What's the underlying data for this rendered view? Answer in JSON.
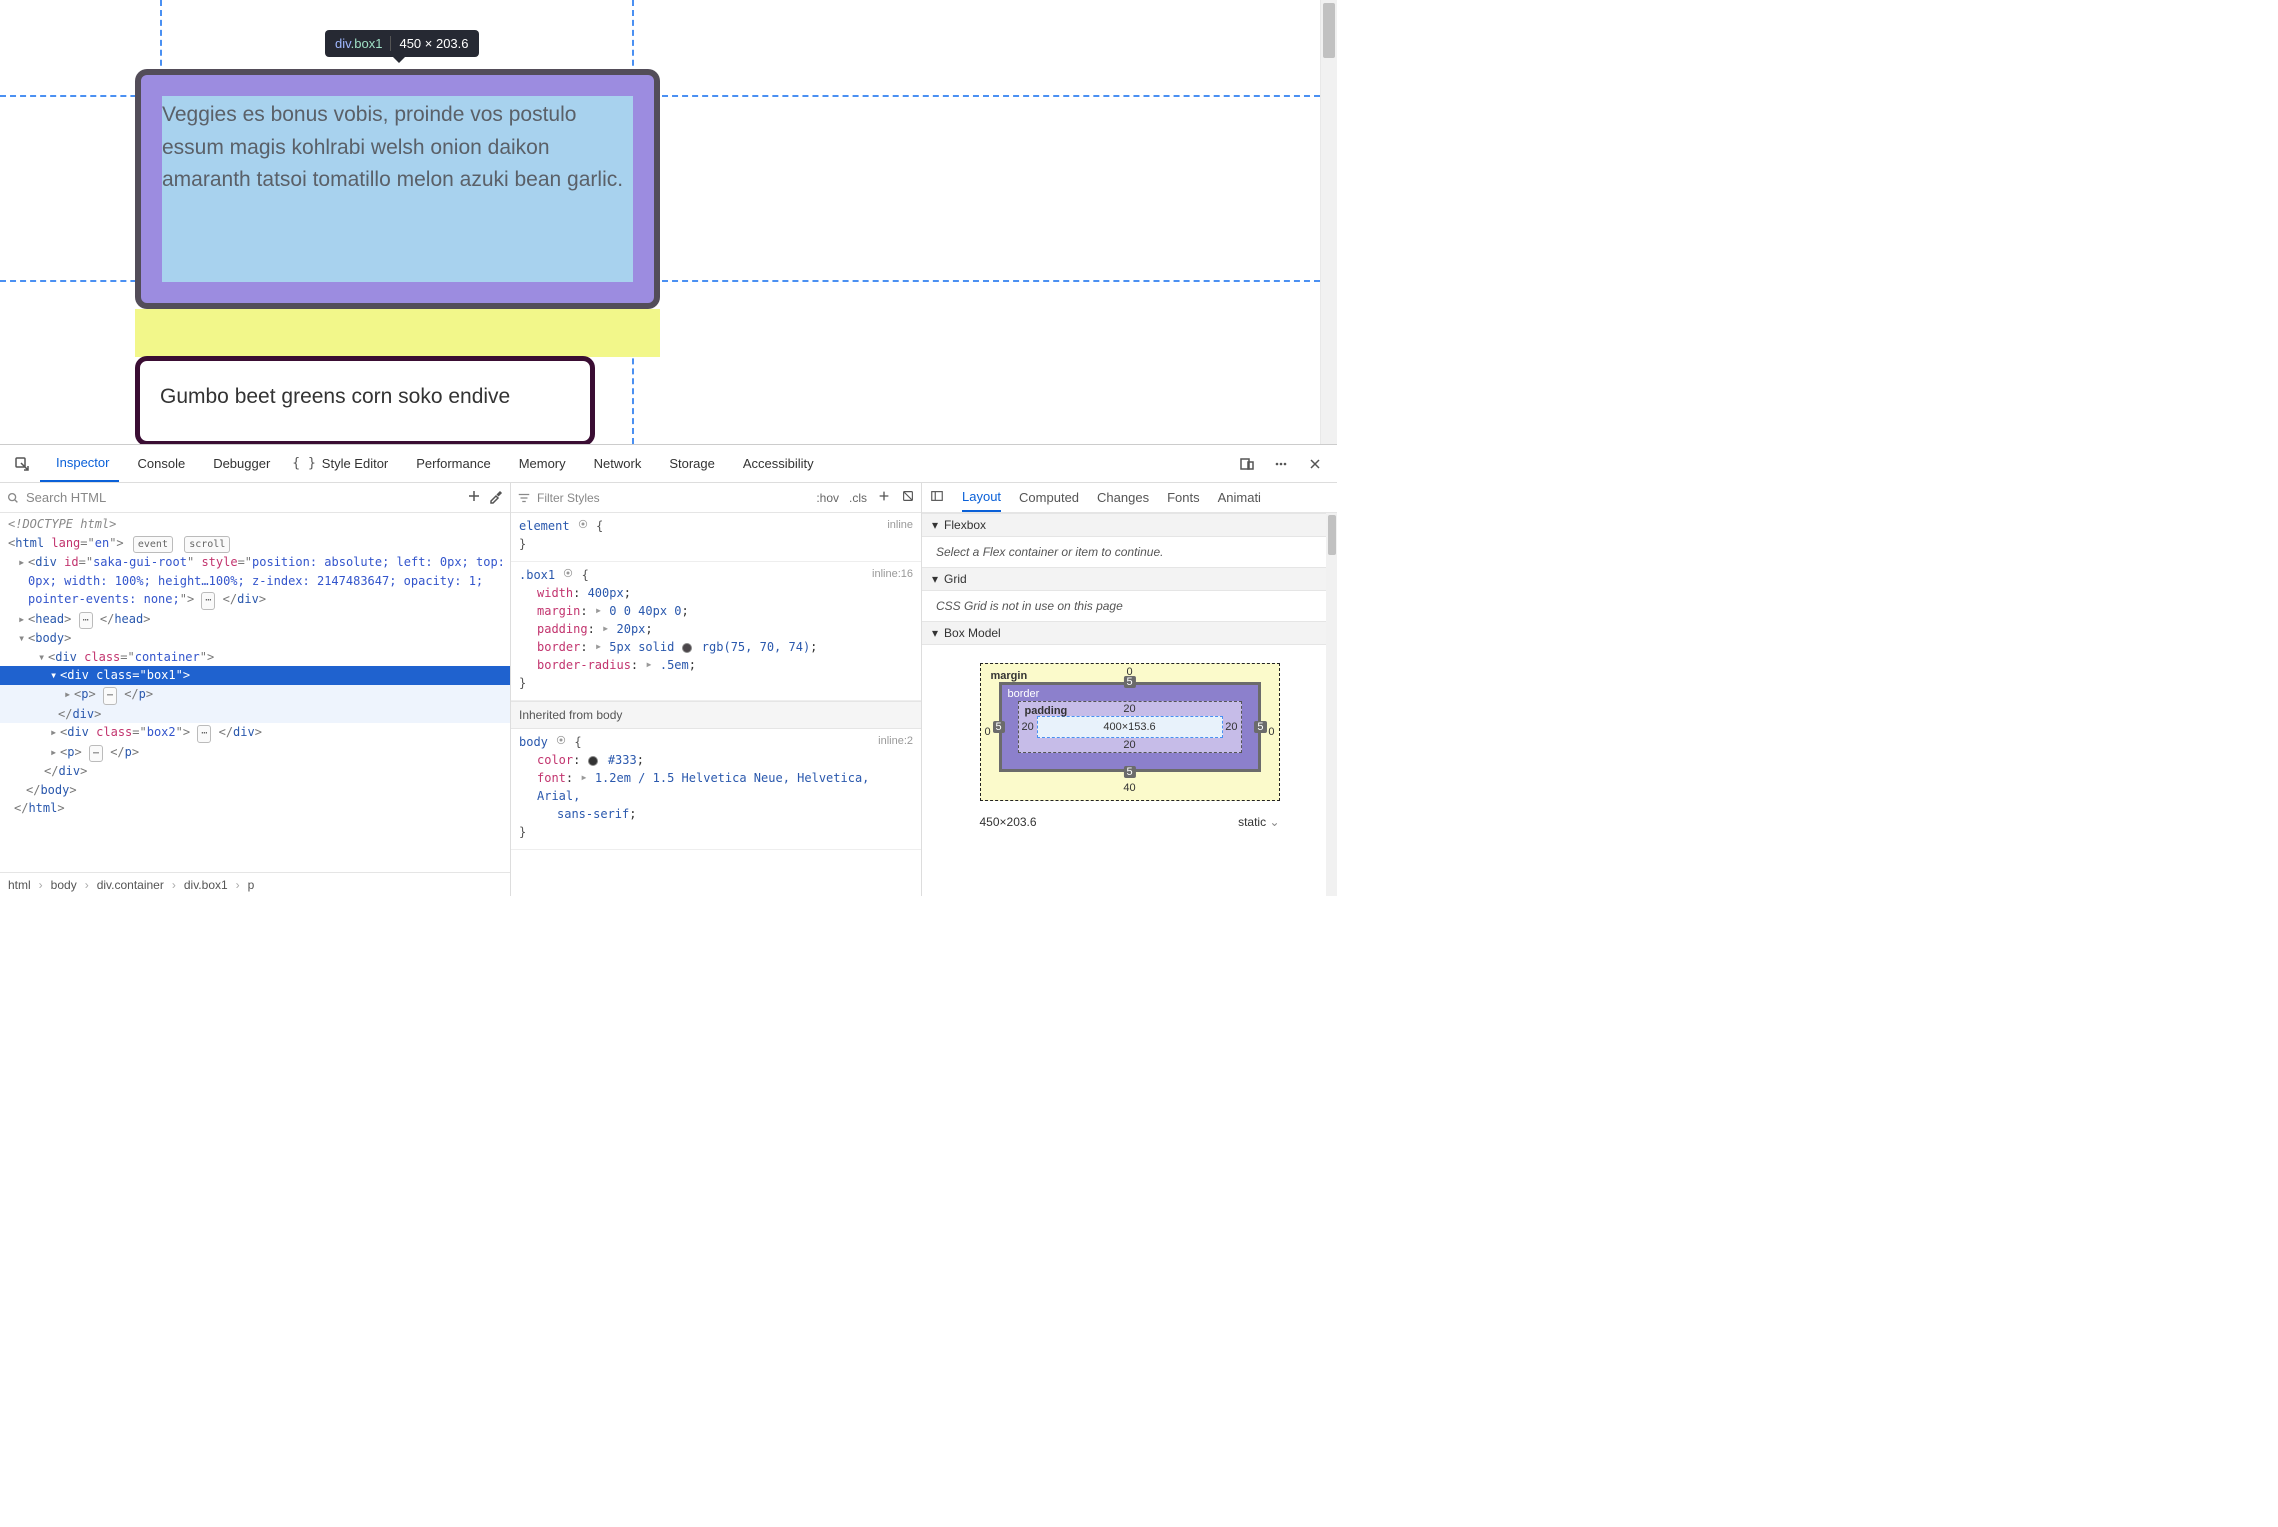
{
  "tooltip": {
    "tag": "div",
    "class": ".box1",
    "dimensions": "450 × 203.6"
  },
  "page": {
    "box1_text": "Veggies es bonus vobis, proinde vos postulo essum magis kohlrabi welsh onion daikon amaranth tatsoi tomatillo melon azuki bean garlic.",
    "box2_text": "Gumbo beet greens corn soko endive"
  },
  "devtools": {
    "tabs": {
      "inspector": "Inspector",
      "console": "Console",
      "debugger": "Debugger",
      "style_editor": "Style Editor",
      "performance": "Performance",
      "memory": "Memory",
      "network": "Network",
      "storage": "Storage",
      "accessibility": "Accessibility"
    },
    "dom_search_placeholder": "Search HTML",
    "dom_tree": {
      "doctype": "<!DOCTYPE html>",
      "html_open": "<html lang=\"en\">",
      "badges": {
        "event": "event",
        "scroll": "scroll"
      },
      "saka_line": "<div id=\"saka-gui-root\" style=\"position: absolute; left: 0px; top: 0px; width: 100%; height…100%; z-index: 2147483647; opacity: 1; pointer-events: none;\"> … </div>",
      "head": "<head> … </head>",
      "body_open": "<body>",
      "container_open": "<div class=\"container\">",
      "box1_open": "<div class=\"box1\">",
      "p_open": "<p> … </p>",
      "div_close": "</div>",
      "box2": "<div class=\"box2\"> … </div>",
      "p_open2": "<p> … </p>",
      "body_close": "</body>",
      "html_close": "</html>"
    },
    "breadcrumbs": [
      "html",
      "body",
      "div.container",
      "div.box1",
      "p"
    ],
    "rules": {
      "filter_placeholder": "Filter Styles",
      "hov": ":hov",
      "cls": ".cls",
      "element": {
        "selector": "element",
        "src": "inline"
      },
      "box1": {
        "selector": ".box1",
        "src": "inline:16",
        "declarations": [
          {
            "prop": "width",
            "value": "400px"
          },
          {
            "prop": "margin",
            "value": "0 0 40px 0",
            "expand": true
          },
          {
            "prop": "padding",
            "value": "20px",
            "expand": true
          },
          {
            "prop": "border",
            "value": "5px solid rgb(75, 70, 74)",
            "expand": true,
            "swatch": "#4b464a"
          },
          {
            "prop": "border-radius",
            "value": ".5em",
            "expand": true
          }
        ]
      },
      "inherited_from": "Inherited from body",
      "body": {
        "selector": "body",
        "src": "inline:2",
        "declarations": [
          {
            "prop": "color",
            "value": "#333",
            "swatch": "#333"
          },
          {
            "prop": "font",
            "value": "1.2em / 1.5 Helvetica Neue, Helvetica, Arial, sans-serif",
            "expand": true
          }
        ]
      }
    },
    "layout": {
      "tabs": {
        "layout": "Layout",
        "computed": "Computed",
        "changes": "Changes",
        "fonts": "Fonts",
        "animations": "Animati"
      },
      "flexbox": {
        "title": "Flexbox",
        "hint": "Select a Flex container or item to continue."
      },
      "grid": {
        "title": "Grid",
        "hint": "CSS Grid is not in use on this page"
      },
      "box_model": {
        "title": "Box Model",
        "margin_label": "margin",
        "border_label": "border",
        "padding_label": "padding",
        "content": "400×153.6",
        "margin": {
          "top": "0",
          "right": "0",
          "bottom": "40",
          "left": "0"
        },
        "border": {
          "top": "5",
          "right": "5",
          "bottom": "5",
          "left": "5"
        },
        "padding": {
          "top": "20",
          "right": "20",
          "bottom": "20",
          "left": "20"
        },
        "footer_size": "450×203.6",
        "position": "static"
      }
    }
  }
}
